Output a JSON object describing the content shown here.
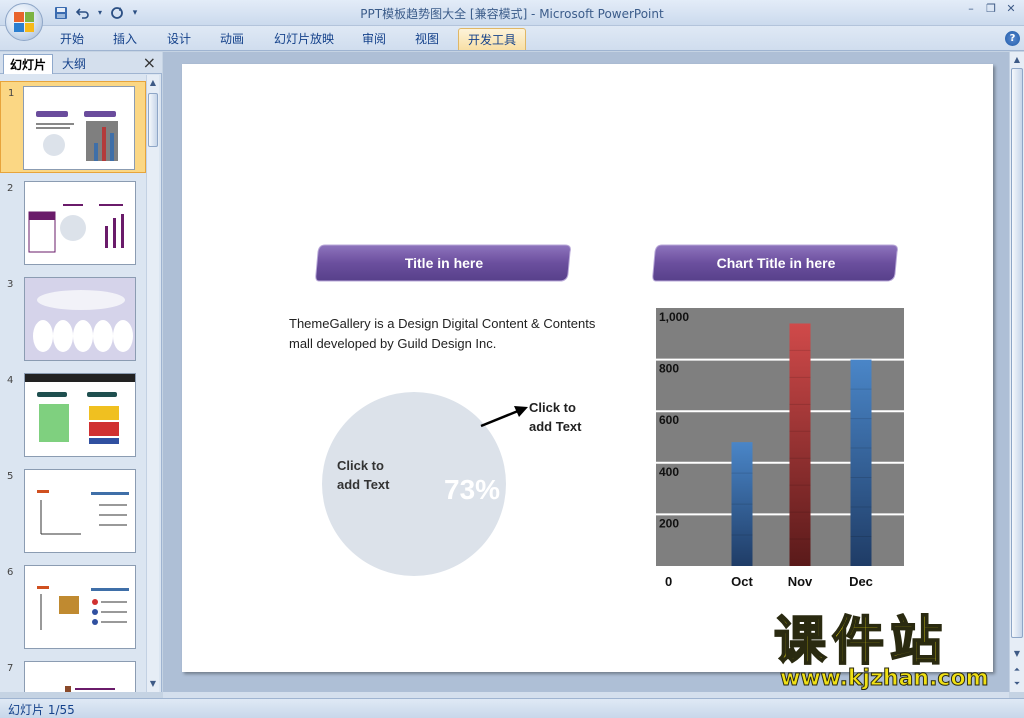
{
  "window": {
    "title": "PPT模板趋势图大全 [兼容模式] - Microsoft PowerPoint"
  },
  "qat": {
    "save_icon": "save-icon",
    "undo_icon": "undo-icon",
    "redo_icon": "redo-icon",
    "customize_icon": "customize-icon"
  },
  "ribbon": {
    "tabs": [
      {
        "label": "开始"
      },
      {
        "label": "插入"
      },
      {
        "label": "设计"
      },
      {
        "label": "动画"
      },
      {
        "label": "幻灯片放映"
      },
      {
        "label": "审阅"
      },
      {
        "label": "视图"
      },
      {
        "label": "开发工具"
      }
    ],
    "active_tab": "开发工具"
  },
  "pane": {
    "tabs": [
      {
        "label": "幻灯片"
      },
      {
        "label": "大纲"
      }
    ],
    "close": "×",
    "thumbnails": [
      {
        "number": "1"
      },
      {
        "number": "2"
      },
      {
        "number": "3"
      },
      {
        "number": "4"
      },
      {
        "number": "5"
      },
      {
        "number": "6"
      },
      {
        "number": "7"
      }
    ],
    "selected": 1
  },
  "slide": {
    "left_title": "Title in here",
    "right_title": "Chart Title in here",
    "body_text": "ThemeGallery  is a Design Digital Content & Contents mall developed by Guild Design Inc.",
    "pie_inner_line1": "Click to",
    "pie_inner_line2": "add Text",
    "pie_percent": "73%",
    "callout_line1": "Click to",
    "callout_line2": "add Text",
    "colors": {
      "banner": "#6a4c9c",
      "chart_bg": "#7f7f7f",
      "blue_bar": "#3f6fa8",
      "red_bar": "#b23a3a",
      "pie": "#dce2ea"
    }
  },
  "chart_data": {
    "type": "bar",
    "categories": [
      "Oct",
      "Nov",
      "Dec"
    ],
    "values": [
      480,
      940,
      800
    ],
    "bar_colors": [
      "#3f6fa8",
      "#b23a3a",
      "#3f6fa8"
    ],
    "yticks": [
      "1,000",
      "800",
      "600",
      "400",
      "200"
    ],
    "zero_label": "0",
    "ylim": [
      0,
      1000
    ],
    "grid": true
  },
  "status": {
    "text": "幻灯片 1/55"
  },
  "watermark": {
    "chinese": "课件站",
    "url": "www.kjzhan.com"
  }
}
